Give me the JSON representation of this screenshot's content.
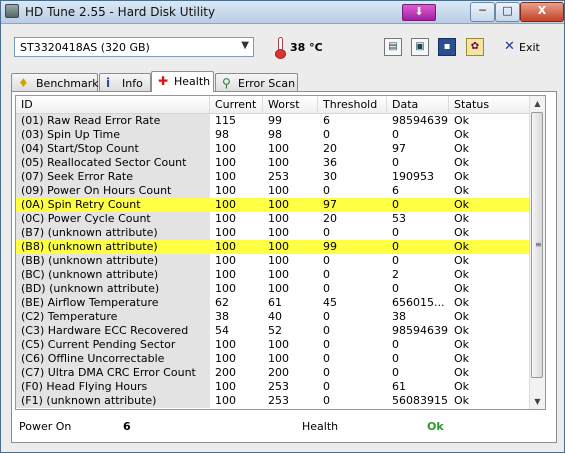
{
  "window": {
    "title": "HD Tune 2.55 - Hard Disk Utility",
    "minimize": "─",
    "maximize": "□",
    "close": "X"
  },
  "toolbar": {
    "drive": "ST3320418AS (320 GB)",
    "temperature": "38 °C",
    "exit_label": "Exit"
  },
  "tabs": [
    {
      "label": "Benchmark",
      "icon": "lightbulb-icon"
    },
    {
      "label": "Info",
      "icon": "info-icon"
    },
    {
      "label": "Health",
      "icon": "health-cross-icon",
      "active": true
    },
    {
      "label": "Error Scan",
      "icon": "magnifier-icon"
    }
  ],
  "table": {
    "columns": [
      "ID",
      "Current",
      "Worst",
      "Threshold",
      "Data",
      "Status"
    ],
    "rows": [
      [
        "(01) Raw Read Error Rate",
        "115",
        "99",
        "6",
        "98594639",
        "Ok"
      ],
      [
        "(03) Spin Up Time",
        "98",
        "98",
        "0",
        "0",
        "Ok"
      ],
      [
        "(04) Start/Stop Count",
        "100",
        "100",
        "20",
        "97",
        "Ok"
      ],
      [
        "(05) Reallocated Sector Count",
        "100",
        "100",
        "36",
        "0",
        "Ok"
      ],
      [
        "(07) Seek Error Rate",
        "100",
        "253",
        "30",
        "190953",
        "Ok"
      ],
      [
        "(09) Power On Hours Count",
        "100",
        "100",
        "0",
        "6",
        "Ok"
      ],
      [
        "(0A) Spin Retry Count",
        "100",
        "100",
        "97",
        "0",
        "Ok"
      ],
      [
        "(0C) Power Cycle Count",
        "100",
        "100",
        "20",
        "53",
        "Ok"
      ],
      [
        "(B7) (unknown attribute)",
        "100",
        "100",
        "0",
        "0",
        "Ok"
      ],
      [
        "(B8) (unknown attribute)",
        "100",
        "100",
        "99",
        "0",
        "Ok"
      ],
      [
        "(BB) (unknown attribute)",
        "100",
        "100",
        "0",
        "0",
        "Ok"
      ],
      [
        "(BC) (unknown attribute)",
        "100",
        "100",
        "0",
        "2",
        "Ok"
      ],
      [
        "(BD) (unknown attribute)",
        "100",
        "100",
        "0",
        "0",
        "Ok"
      ],
      [
        "(BE) Airflow Temperature",
        "62",
        "61",
        "45",
        "656015...",
        "Ok"
      ],
      [
        "(C2) Temperature",
        "38",
        "40",
        "0",
        "38",
        "Ok"
      ],
      [
        "(C3) Hardware ECC Recovered",
        "54",
        "52",
        "0",
        "98594639",
        "Ok"
      ],
      [
        "(C5) Current Pending Sector",
        "100",
        "100",
        "0",
        "0",
        "Ok"
      ],
      [
        "(C6) Offline Uncorrectable",
        "100",
        "100",
        "0",
        "0",
        "Ok"
      ],
      [
        "(C7) Ultra DMA CRC Error Count",
        "200",
        "200",
        "0",
        "0",
        "Ok"
      ],
      [
        "(F0) Head Flying Hours",
        "100",
        "253",
        "0",
        "61",
        "Ok"
      ],
      [
        "(F1) (unknown attribute)",
        "100",
        "253",
        "0",
        "56083915",
        "Ok"
      ]
    ],
    "highlighted_rows": [
      6,
      9
    ],
    "highlight_color": "#ffff44"
  },
  "status": {
    "power_on_label": "Power On",
    "power_on_value": "6",
    "health_label": "Health",
    "health_value": "Ok"
  }
}
